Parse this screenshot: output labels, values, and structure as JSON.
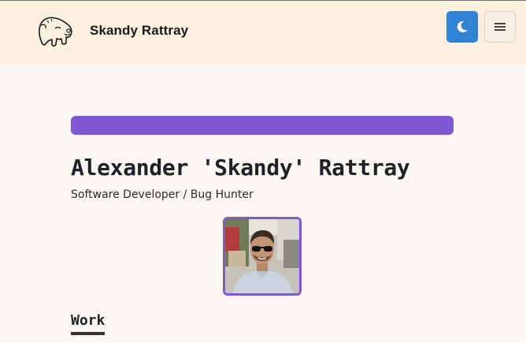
{
  "header": {
    "site_title": "Skandy Rattray",
    "logo_icon": "dinosaur-logo-icon",
    "theme_toggle_icon": "moon-icon",
    "menu_icon": "hamburger-menu-icon"
  },
  "hero": {
    "name": "Alexander 'Skandy' Rattray",
    "tagline": "Software Developer / Bug Hunter",
    "avatar_alt": "profile-photo"
  },
  "sections": {
    "work_title": "Work"
  },
  "colors": {
    "header_bg": "#fbf0dd",
    "page_bg": "#fbf8f3",
    "accent": "#8058d5",
    "theme_button": "#2f82d4"
  }
}
